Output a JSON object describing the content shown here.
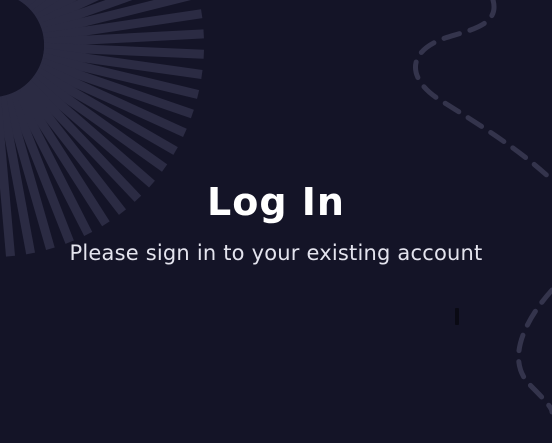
{
  "header": {
    "title": "Log In",
    "subtitle": "Please sign in to your existing account"
  },
  "decorations": {
    "top_left": "sunburst-decoration",
    "right": "dashed-path-decoration"
  },
  "colors": {
    "background": "#141427",
    "title": "#ffffff",
    "subtitle": "#e4e4ee",
    "rays": "#2b2b43",
    "dashes": "#34344c"
  }
}
